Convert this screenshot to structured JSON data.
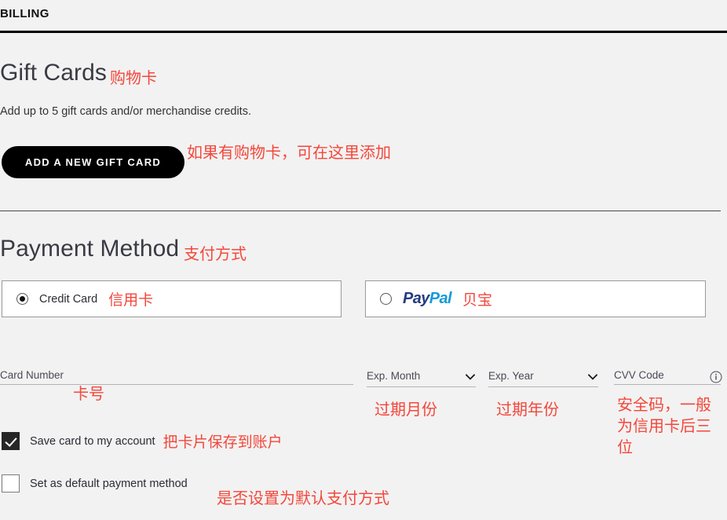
{
  "header": {
    "title": "BILLING"
  },
  "gift_cards": {
    "title": "Gift Cards",
    "title_annotation": "购物卡",
    "description": "Add up to 5 gift cards and/or merchandise credits.",
    "add_button_label": "ADD A NEW GIFT CARD",
    "add_button_annotation": "如果有购物卡，可在这里添加"
  },
  "payment_method": {
    "title": "Payment Method",
    "title_annotation": "支付方式",
    "options": [
      {
        "id": "credit-card",
        "label": "Credit Card",
        "annotation": "信用卡",
        "selected": true
      },
      {
        "id": "paypal",
        "logo_part_1": "Pay",
        "logo_part_2": "Pal",
        "annotation": "贝宝",
        "selected": false
      }
    ],
    "fields": [
      {
        "id": "card-number",
        "label": "Card Number",
        "value": "",
        "annotation": "卡号",
        "type": "text"
      },
      {
        "id": "exp-month",
        "label": "Exp. Month",
        "value": "",
        "annotation": "过期月份",
        "type": "select"
      },
      {
        "id": "exp-year",
        "label": "Exp. Year",
        "value": "",
        "annotation": "过期年份",
        "type": "select"
      },
      {
        "id": "cvv-code",
        "label": "CVV Code",
        "value": "",
        "annotation": "安全码，一般为信用卡后三位",
        "type": "text",
        "icon": "info-circle-icon"
      }
    ],
    "checkboxes": [
      {
        "id": "save-card",
        "label": "Save card to my account",
        "annotation": "把卡片保存到账户",
        "checked": true
      },
      {
        "id": "default-payment",
        "label": "Set as default payment method",
        "annotation": "是否设置为默认支付方式",
        "checked": false
      }
    ]
  },
  "colors": {
    "annotation_red": "#f4473b",
    "background": "#f2f2f2",
    "button_black": "#000000",
    "paypal_dark": "#253b80",
    "paypal_light": "#179bd7"
  }
}
